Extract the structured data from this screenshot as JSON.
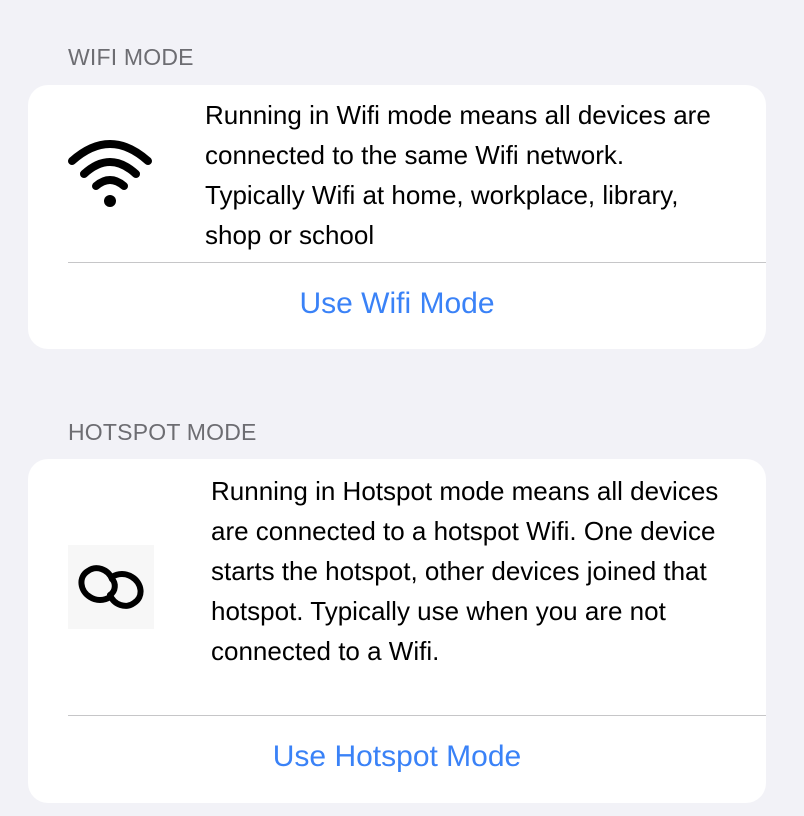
{
  "colors": {
    "background": "#f2f2f7",
    "card": "#ffffff",
    "section_header": "#6d6d72",
    "accent": "#3a82f7",
    "divider": "#c6c6c8"
  },
  "wifi_section": {
    "header": "WIFI MODE",
    "icon": "wifi-icon",
    "description": "Running in Wifi mode means all devices are connected to the same Wifi network. Typically Wifi at home, workplace, library, shop or school",
    "action_label": "Use Wifi Mode"
  },
  "hotspot_section": {
    "header": "HOTSPOT MODE",
    "icon": "hotspot-link-icon",
    "description": "Running in Hotspot mode means all devices are connected to a hotspot Wifi. One device starts the hotspot, other devices joined that hotspot. Typically use when you are not connected to a Wifi.",
    "action_label": "Use Hotspot Mode"
  }
}
